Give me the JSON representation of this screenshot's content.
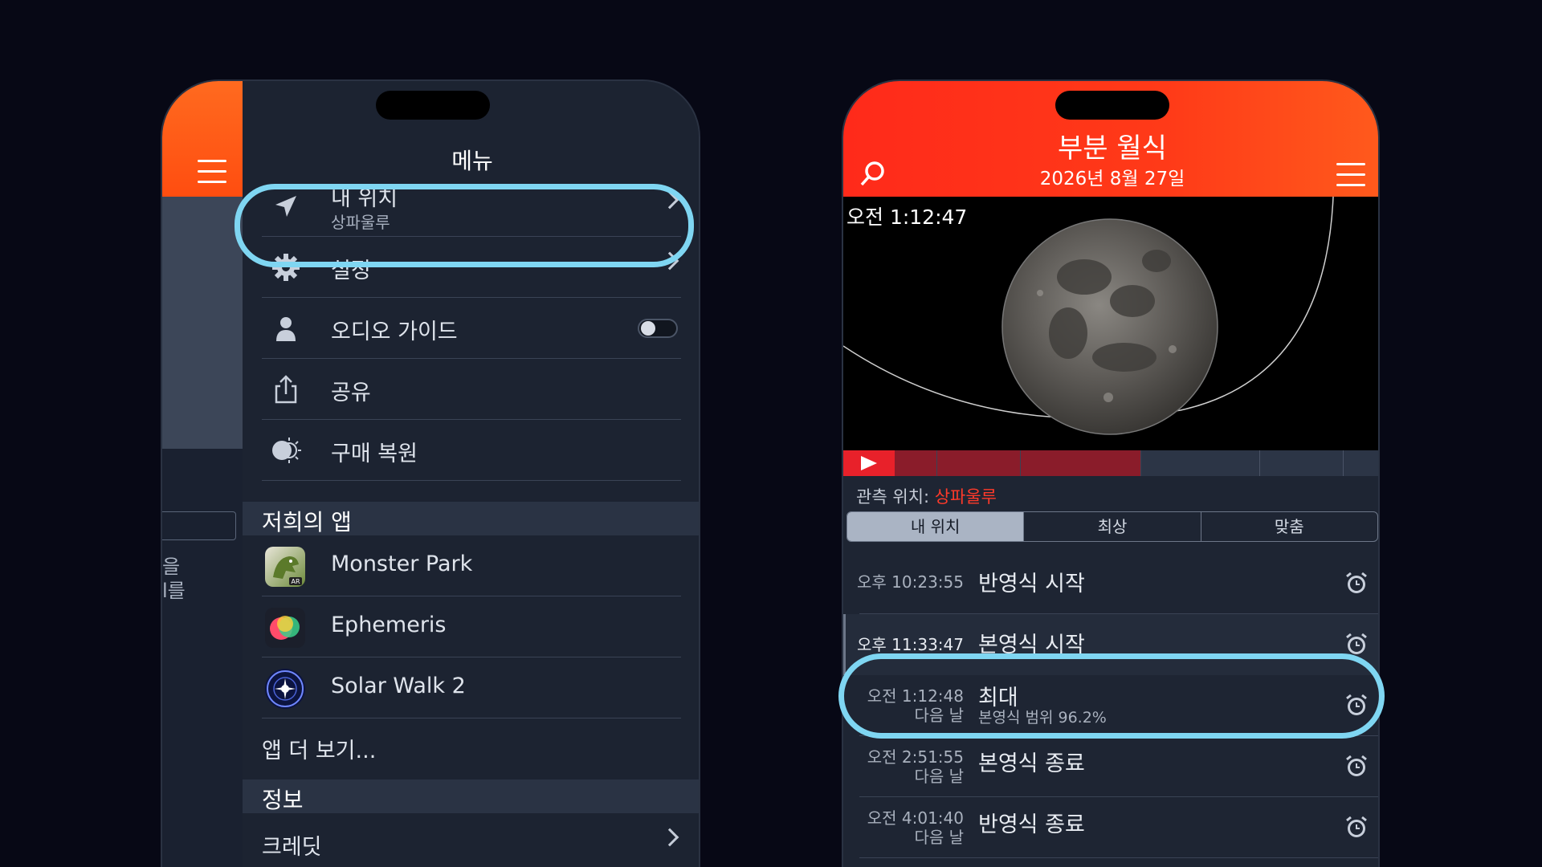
{
  "menu_phone": {
    "title": "메뉴",
    "items": [
      {
        "label": "내 위치",
        "sub": "상파울루"
      },
      {
        "label": "설정"
      },
      {
        "label": "오디오 가이드"
      },
      {
        "label": "공유"
      },
      {
        "label": "구매 복원"
      }
    ],
    "audio_guide_enabled": false,
    "section_apps": "저희의 앱",
    "apps": [
      "Monster Park",
      "Ephemeris",
      "Solar Walk 2"
    ],
    "more_apps": "앱 더 보기...",
    "section_info": "정보",
    "credits": "크레딧",
    "background_snippet": [
      "을",
      "l를"
    ]
  },
  "eclipse_phone": {
    "title": "부분 월식",
    "date": "2026년 8월 27일",
    "sky_time": "오전 1:12:47",
    "observation_label": "관측 위치:",
    "observation_location": "상파울루",
    "tabs": [
      "내 위치",
      "최상",
      "맞춤"
    ],
    "active_tab": 0,
    "events": [
      {
        "time": "오후 10:23:55",
        "next_day": "",
        "name": "반영식 시작",
        "desc": ""
      },
      {
        "time": "오후 11:33:47",
        "next_day": "",
        "name": "본영식 시작",
        "desc": ""
      },
      {
        "time": "오전 1:12:48",
        "next_day": "다음 날",
        "name": "최대",
        "desc": "본영식 범위 96.2%"
      },
      {
        "time": "오전 2:51:55",
        "next_day": "다음 날",
        "name": "본영식 종료",
        "desc": ""
      },
      {
        "time": "오전 4:01:40",
        "next_day": "다음 날",
        "name": "반영식 종료",
        "desc": ""
      }
    ]
  },
  "colors": {
    "background": "#070815",
    "highlight": "#7fd6f2",
    "header_red": "#ff2a1a",
    "accent_orange": "#ff6a1f",
    "location_red": "#ff3a2a"
  }
}
